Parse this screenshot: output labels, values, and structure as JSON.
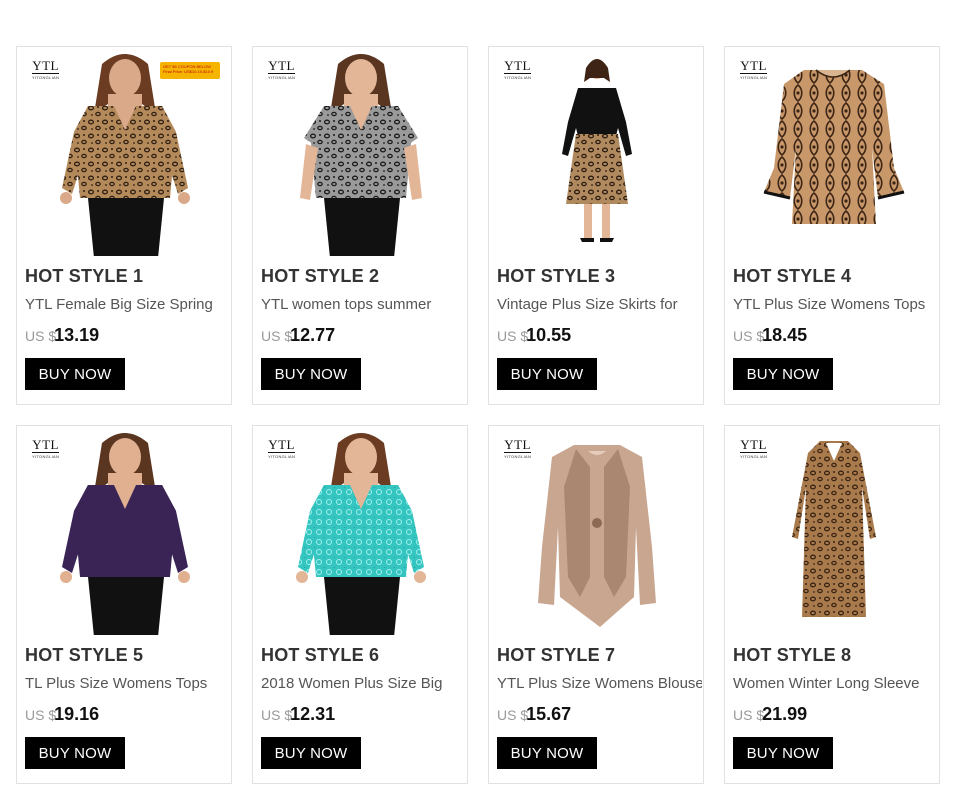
{
  "products": [
    {
      "title": "HOT STYLE 1",
      "desc": "YTL Female Big Size Spring",
      "currency": "US $",
      "amount": "13.19",
      "button": "BUY NOW",
      "brand": "YTL",
      "brand_sub": "YITONGLIAN",
      "promo": "GET $5 COUPON BELOW Final Price: US$10.19-$10.9",
      "pattern": "leopard",
      "cloth": "#b58a5a",
      "cloth_dark": "#2e1f14",
      "legs": "#111111",
      "skin": "#d9a98a",
      "hair": "#6b3b22",
      "icon": "woman-leopard-top"
    },
    {
      "title": "HOT STYLE 2",
      "desc": "YTL women tops summer",
      "currency": "US $",
      "amount": "12.77",
      "button": "BUY NOW",
      "brand": "YTL",
      "brand_sub": "YITONGLIAN",
      "pattern": "leopard",
      "cloth": "#9a9a9a",
      "cloth_dark": "#1a1a1a",
      "legs": "#111111",
      "skin": "#e3b697",
      "hair": "#5a3520",
      "icon": "woman-gray-leopard-top"
    },
    {
      "title": "HOT STYLE 3",
      "desc": "Vintage Plus Size Skirts for",
      "currency": "US $",
      "amount": "10.55",
      "button": "BUY NOW",
      "brand": "YTL",
      "brand_sub": "YITONGLIAN",
      "pattern": "skirt",
      "cloth": "#111111",
      "cloth_dark": "#b08a5e",
      "legs": "#e3b697",
      "skin": "#e3b697",
      "hair": "#3d2414",
      "icon": "woman-leopard-skirt"
    },
    {
      "title": "HOT STYLE 4",
      "desc": "YTL Plus Size Womens Tops",
      "currency": "US $",
      "amount": "18.45",
      "button": "BUY NOW",
      "brand": "YTL",
      "brand_sub": "YITONGLIAN",
      "pattern": "lace",
      "cloth": "#c9986a",
      "cloth_dark": "#3b2414",
      "legs": "#ffffff",
      "skin": "#ffffff",
      "hair": "#ffffff",
      "icon": "lace-blouse"
    },
    {
      "title": "HOT STYLE 5",
      "desc": "TL Plus Size Womens Tops",
      "currency": "US $",
      "amount": "19.16",
      "button": "BUY NOW",
      "brand": "YTL",
      "brand_sub": "YITONGLIAN",
      "pattern": "plain",
      "cloth": "#3a2456",
      "cloth_dark": "#241538",
      "legs": "#111111",
      "skin": "#e0b090",
      "hair": "#5a3520",
      "icon": "woman-purple-wrap-top"
    },
    {
      "title": "HOT STYLE 6",
      "desc": "2018 Women Plus Size Big",
      "currency": "US $",
      "amount": "12.31",
      "button": "BUY NOW",
      "brand": "YTL",
      "brand_sub": "YITONGLIAN",
      "pattern": "teal",
      "cloth": "#35c5c0",
      "cloth_dark": "#1b8d8a",
      "legs": "#111111",
      "skin": "#e3b697",
      "hair": "#6b3b22",
      "icon": "woman-teal-lace-top"
    },
    {
      "title": "HOT STYLE 7",
      "desc": "YTL Plus Size Womens Blouse",
      "currency": "US $",
      "amount": "15.67",
      "button": "BUY NOW",
      "brand": "YTL",
      "brand_sub": "YITONGLIAN",
      "pattern": "beige",
      "cloth": "#c8a690",
      "cloth_dark": "#9c7a64",
      "legs": "#ffffff",
      "skin": "#ffffff",
      "hair": "#ffffff",
      "icon": "beige-lace-blouse"
    },
    {
      "title": "HOT STYLE 8",
      "desc": "Women Winter Long Sleeve",
      "currency": "US $",
      "amount": "21.99",
      "button": "BUY NOW",
      "brand": "YTL",
      "brand_sub": "YITONGLIAN",
      "pattern": "dress",
      "cloth": "#a97a4c",
      "cloth_dark": "#3b2414",
      "legs": "#ffffff",
      "skin": "#ffffff",
      "hair": "#ffffff",
      "icon": "leopard-maxi-dress"
    }
  ]
}
